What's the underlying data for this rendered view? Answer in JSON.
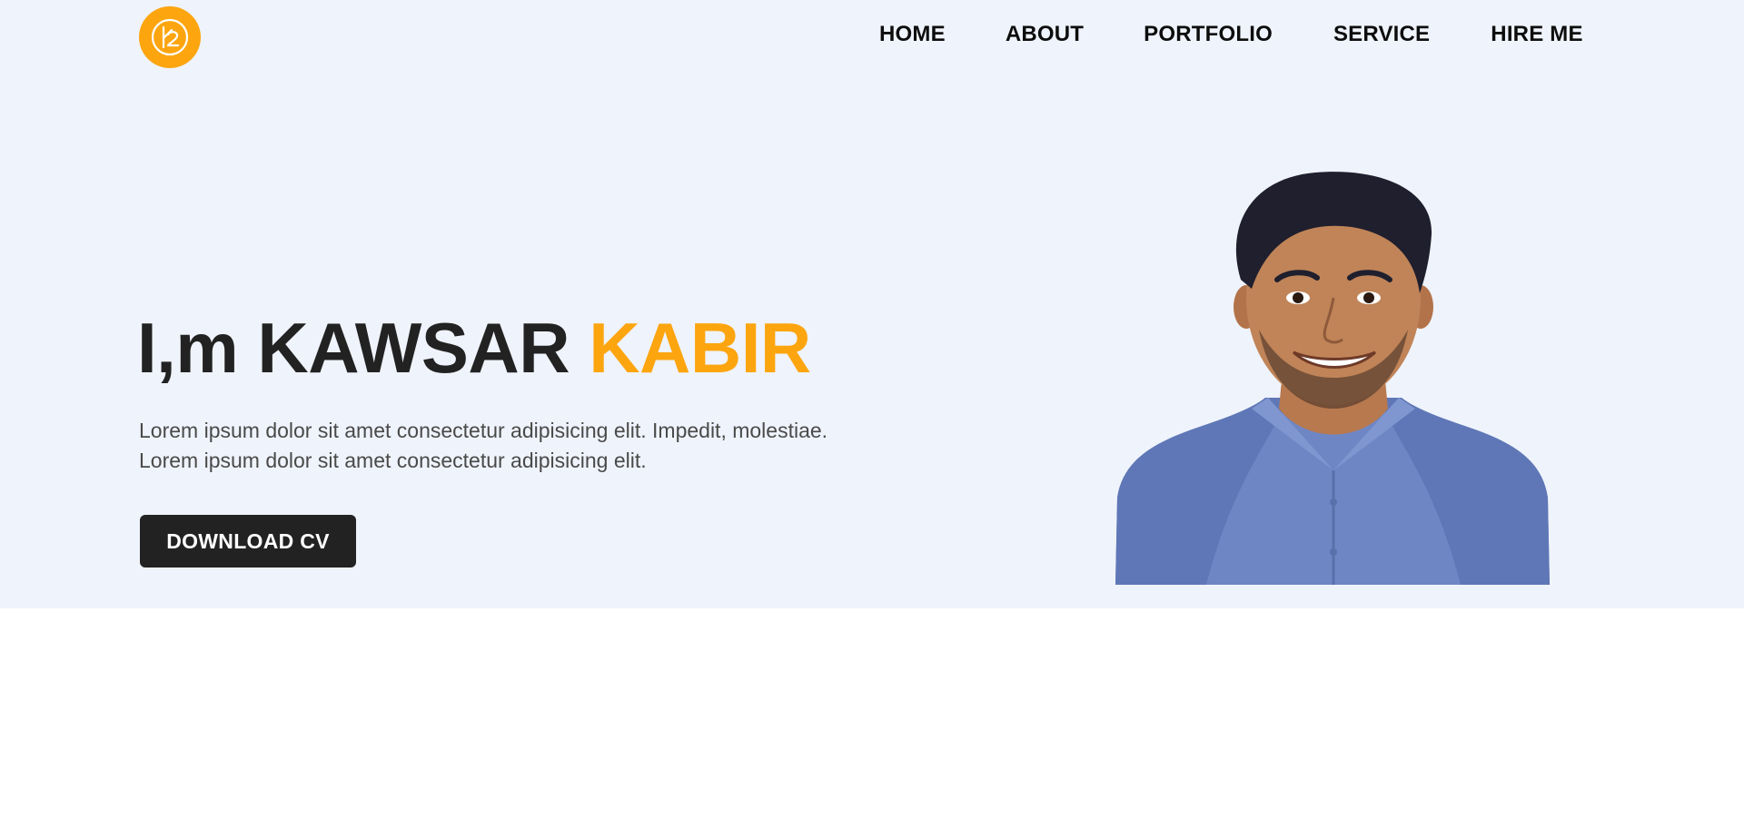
{
  "logo": {
    "icon": "k2-monogram-icon",
    "color": "#fca50f"
  },
  "nav": {
    "items": [
      {
        "label": "HOME"
      },
      {
        "label": "ABOUT"
      },
      {
        "label": "PORTFOLIO"
      },
      {
        "label": "SERVICE"
      },
      {
        "label": "HIRE ME"
      }
    ]
  },
  "hero": {
    "headline_prefix": "I,m KAWSAR ",
    "headline_accent": "KABIR",
    "intro_line_1": "Lorem ipsum dolor sit amet consectetur adipisicing elit. Impedit, molestiae.",
    "intro_line_2": "Lorem ipsum dolor sit amet consectetur adipisicing elit.",
    "cta_label": "DOWNLOAD CV",
    "portrait": "profile-photo"
  },
  "colors": {
    "accent": "#fca50f",
    "hero_background": "#eff3fb",
    "dark": "#222222"
  }
}
